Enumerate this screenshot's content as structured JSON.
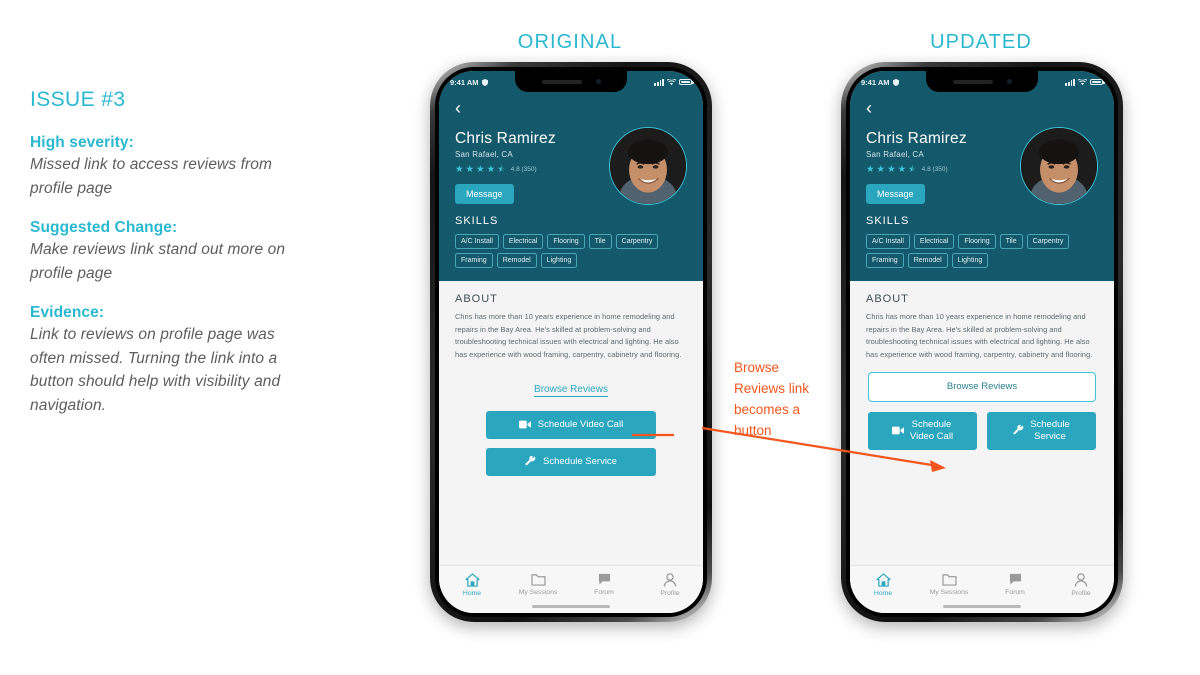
{
  "notes": {
    "title": "ISSUE #3",
    "blocks": [
      {
        "head": "High severity:",
        "body": "Missed link to access reviews from profile page"
      },
      {
        "head": "Suggested Change:",
        "body": "Make reviews link stand out more on profile page"
      },
      {
        "head": "Evidence:",
        "body": "Link to reviews on profile page was often missed. Turning the link into a button should help with visibility and navigation."
      }
    ]
  },
  "columns": {
    "original_label": "ORIGINAL",
    "updated_label": "UPDATED"
  },
  "callout": {
    "text": "Browse Reviews link becomes a button",
    "color": "#f4561d"
  },
  "phone": {
    "statusbar": {
      "time": "9:41 AM"
    },
    "back_icon": "chevron-left-icon",
    "profile": {
      "name": "Chris Ramirez",
      "location": "San Rafael, CA",
      "rating_value": "4.8",
      "rating_count": "(350)",
      "rating_text": "4.8 (350)",
      "stars_full": 4,
      "stars_half": 1,
      "message_label": "Message"
    },
    "skills": {
      "title": "SKILLS",
      "chips": [
        "A/C Install",
        "Electrical",
        "Flooring",
        "Tile",
        "Carpentry",
        "Framing",
        "Remodel",
        "Lighting"
      ]
    },
    "about": {
      "title": "ABOUT",
      "text": "Chris has more than 10 years experience in home remodeling and repairs in the Bay Area.  He's skilled at problem-solving and troubleshooting technical issues with electrical and lighting. He also has experience with wood framing, carpentry, cabinetry and flooring."
    },
    "actions": {
      "browse_reviews": "Browse Reviews",
      "schedule_video_call": "Schedule Video Call",
      "schedule_service": "Schedule Service",
      "schedule_video_call_l1": "Schedule",
      "schedule_video_call_l2": "Video Call",
      "schedule_service_l1": "Schedule",
      "schedule_service_l2": "Service"
    },
    "tabs": [
      {
        "label": "Home",
        "icon": "home-icon",
        "active": true
      },
      {
        "label": "My Sessions",
        "icon": "folder-icon",
        "active": false
      },
      {
        "label": "Forum",
        "icon": "chat-bubble-icon",
        "active": false
      },
      {
        "label": "Profile",
        "icon": "person-icon",
        "active": false
      }
    ]
  },
  "colors": {
    "accent_teal": "#29b8d0",
    "header_teal": "#14596b",
    "button_teal": "#2aa7bf",
    "callout_orange": "#f4561d",
    "body_gray": "#5d5d5d"
  }
}
